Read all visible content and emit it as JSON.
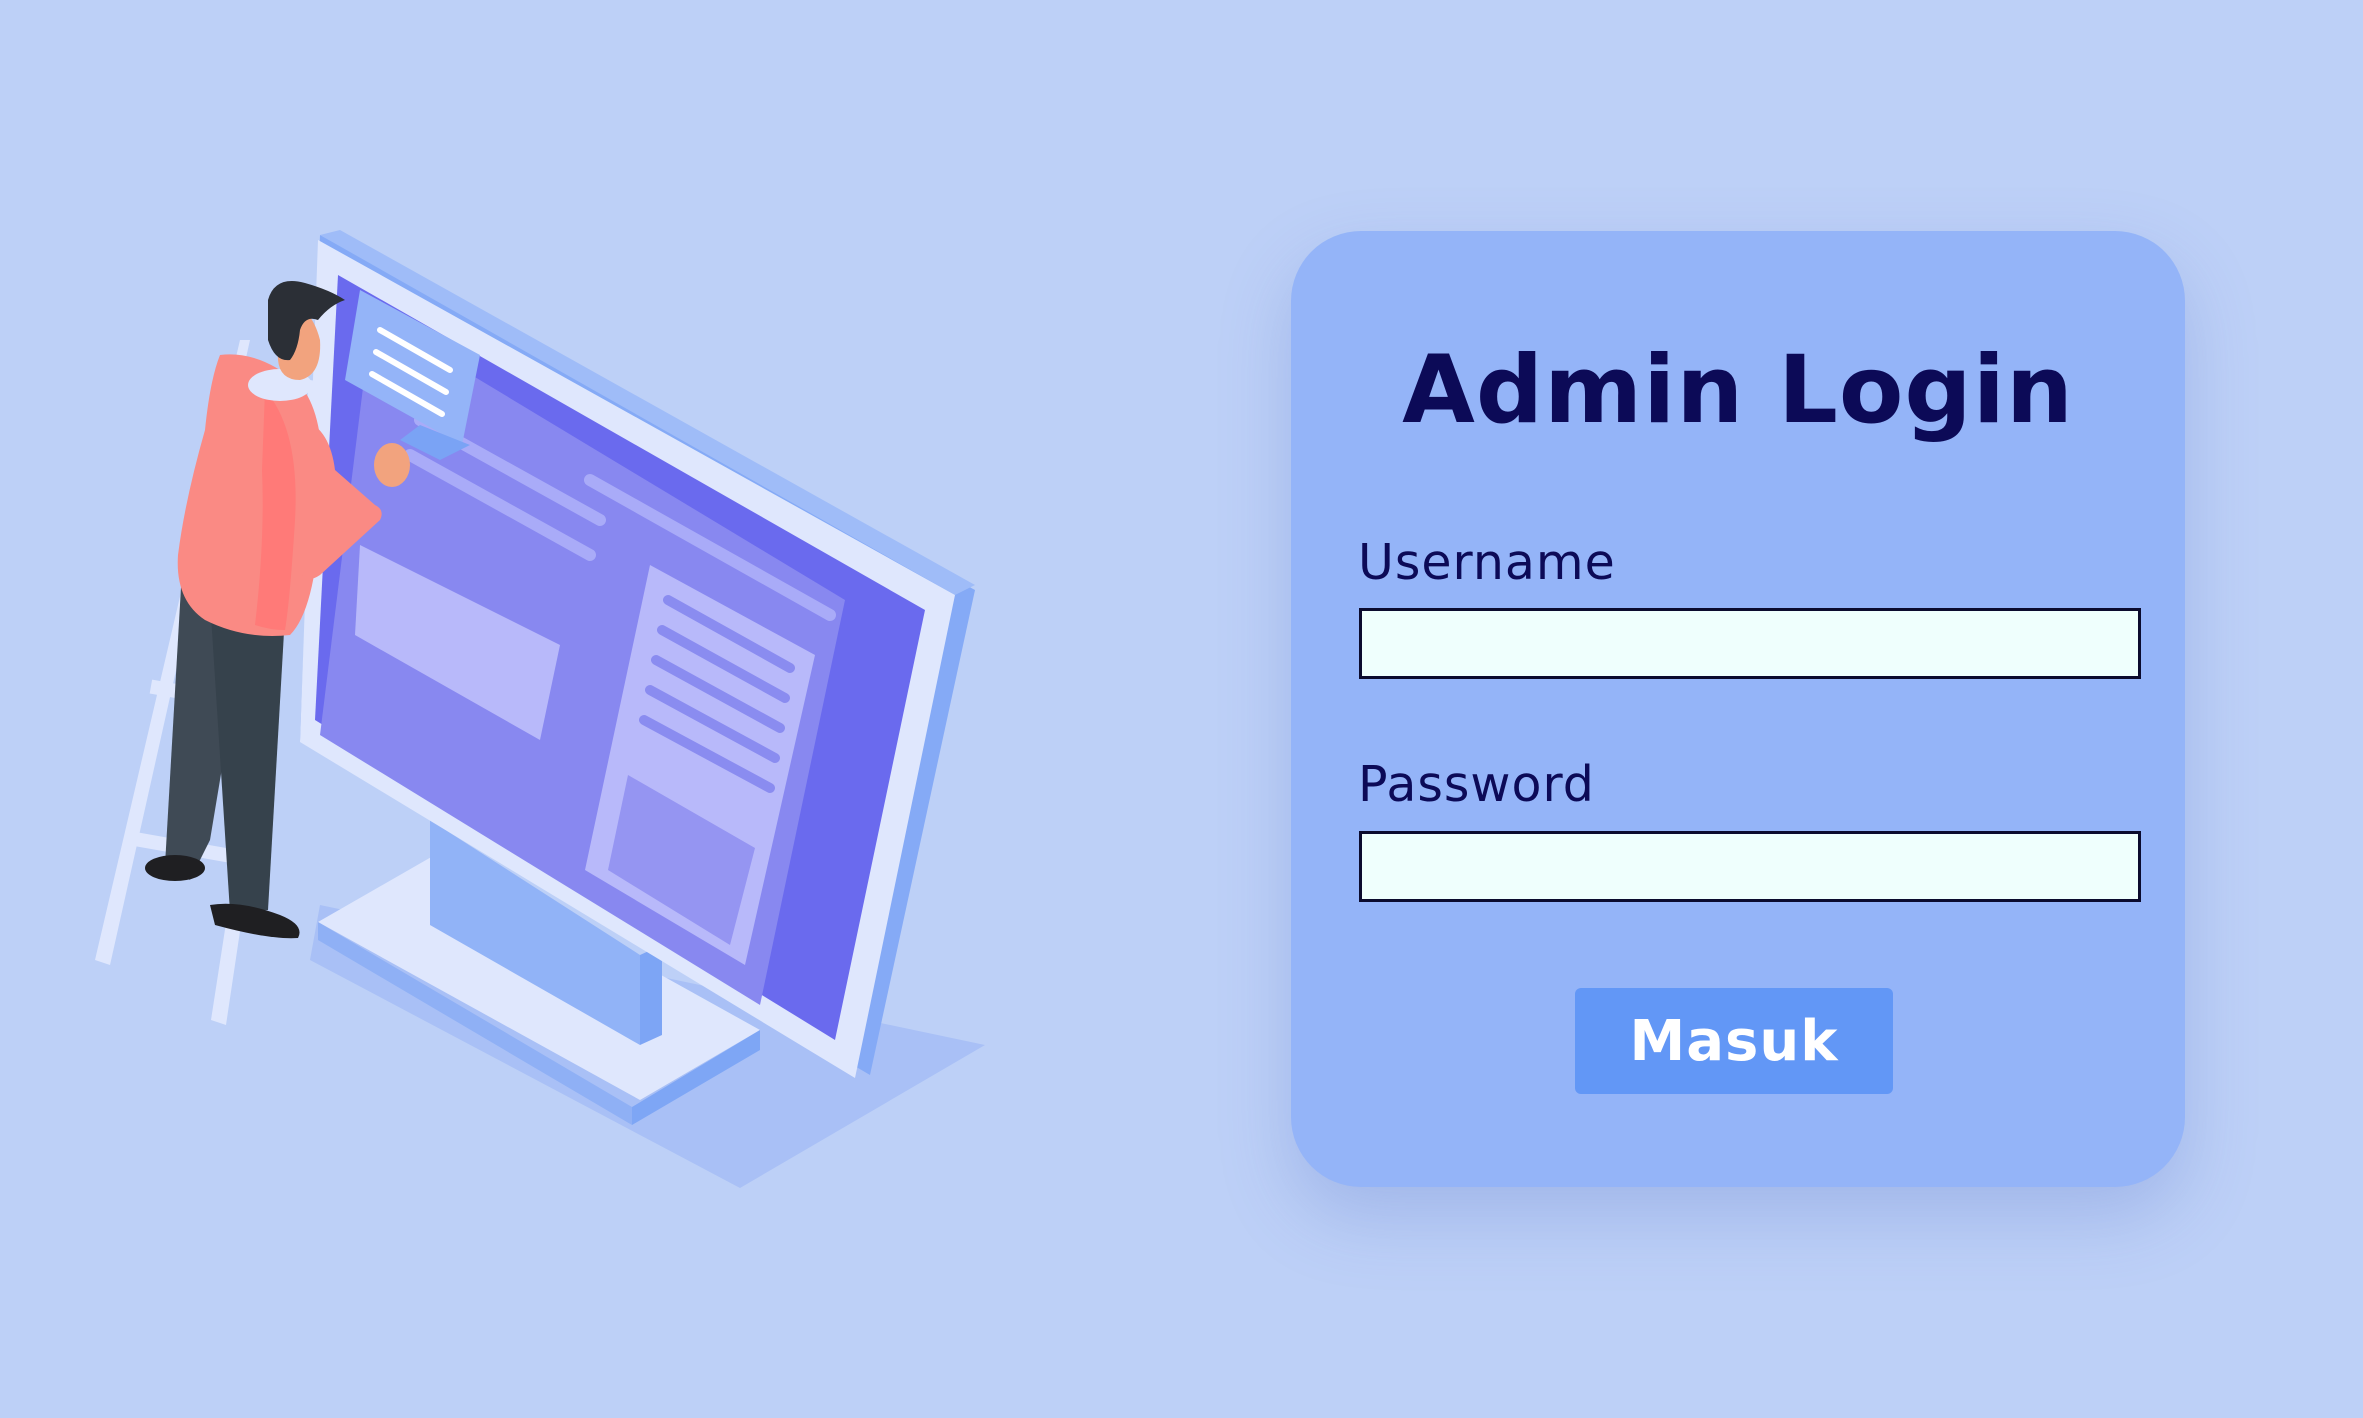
{
  "login": {
    "title": "Admin Login",
    "username_label": "Username",
    "username_value": "",
    "password_label": "Password",
    "password_value": "",
    "submit_label": "Masuk"
  },
  "colors": {
    "background": "#bdd0f7",
    "card": "#94b4f8",
    "title_text": "#0c0a57",
    "input_fill": "#effffd",
    "button": "#6297f6",
    "monitor_screen": "#6a6aee",
    "person_shirt": "#fa8a84"
  },
  "illustration": {
    "subject": "person-at-monitor-illustration"
  }
}
